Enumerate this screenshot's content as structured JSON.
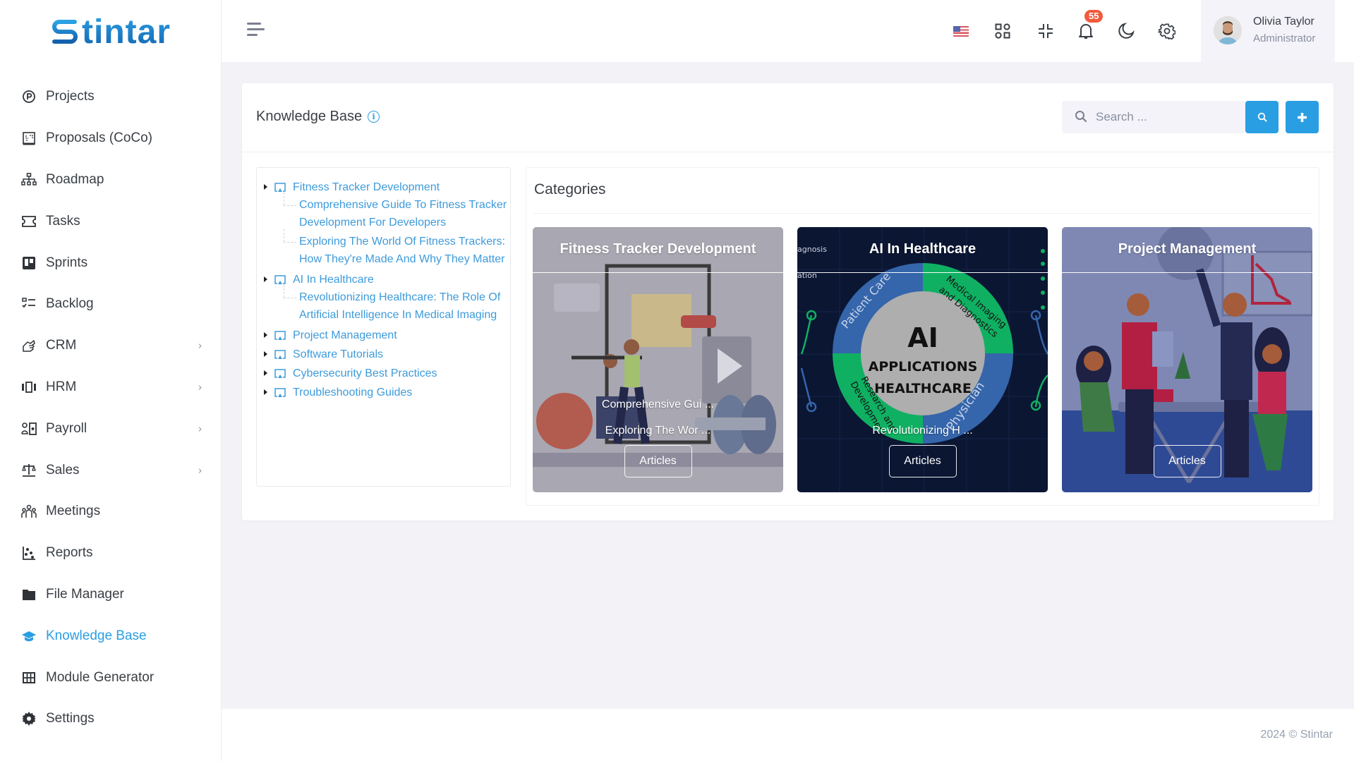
{
  "brand": {
    "name": "tintar",
    "logo_letter": "S"
  },
  "sidebar": {
    "items": [
      {
        "label": "Projects",
        "icon": "circle-p-icon",
        "has_submenu": false,
        "active": false
      },
      {
        "label": "Proposals (CoCo)",
        "icon": "proposal-icon",
        "has_submenu": false,
        "active": false
      },
      {
        "label": "Roadmap",
        "icon": "sitemap-icon",
        "has_submenu": false,
        "active": false
      },
      {
        "label": "Tasks",
        "icon": "ticket-icon",
        "has_submenu": false,
        "active": false
      },
      {
        "label": "Sprints",
        "icon": "board-icon",
        "has_submenu": false,
        "active": false
      },
      {
        "label": "Backlog",
        "icon": "checklist-icon",
        "has_submenu": false,
        "active": false
      },
      {
        "label": "CRM",
        "icon": "handshake-icon",
        "has_submenu": true,
        "active": false
      },
      {
        "label": "HRM",
        "icon": "carousel-icon",
        "has_submenu": true,
        "active": false
      },
      {
        "label": "Payroll",
        "icon": "payroll-icon",
        "has_submenu": true,
        "active": false
      },
      {
        "label": "Sales",
        "icon": "scale-icon",
        "has_submenu": true,
        "active": false
      },
      {
        "label": "Meetings",
        "icon": "team-icon",
        "has_submenu": false,
        "active": false
      },
      {
        "label": "Reports",
        "icon": "scatter-icon",
        "has_submenu": false,
        "active": false
      },
      {
        "label": "File Manager",
        "icon": "folder-icon",
        "has_submenu": false,
        "active": false
      },
      {
        "label": "Knowledge Base",
        "icon": "graduation-cap-icon",
        "has_submenu": false,
        "active": true
      },
      {
        "label": "Module Generator",
        "icon": "grid-icon",
        "has_submenu": false,
        "active": false
      },
      {
        "label": "Settings",
        "icon": "cog-icon",
        "has_submenu": false,
        "active": false
      }
    ]
  },
  "header": {
    "notifications_count": "55",
    "icons": [
      "us-flag-icon",
      "apps-grid-icon",
      "fullscreen-exit-icon",
      "bell-icon",
      "moon-icon",
      "gear-icon"
    ],
    "user": {
      "name": "Olivia Taylor",
      "role": "Administrator"
    }
  },
  "page": {
    "title": "Knowledge Base",
    "search": {
      "placeholder": "Search ...",
      "value": ""
    }
  },
  "tree": [
    {
      "label": "Fitness Tracker Development",
      "children": [
        "Comprehensive Guide To Fitness Tracker Development For Developers",
        "Exploring The World Of Fitness Trackers: How They're Made And Why They Matter"
      ]
    },
    {
      "label": "AI In Healthcare",
      "children": [
        "Revolutionizing Healthcare: The Role Of Artificial Intelligence In Medical Imaging"
      ]
    },
    {
      "label": "Project Management",
      "children": []
    },
    {
      "label": "Software Tutorials",
      "children": []
    },
    {
      "label": "Cybersecurity Best Practices",
      "children": []
    },
    {
      "label": "Troubleshooting Guides",
      "children": []
    }
  ],
  "categories": {
    "title": "Categories",
    "cards": [
      {
        "title": "Fitness Tracker Development",
        "links": [
          "Comprehensive Gui ...",
          "Exploring The Wor ..."
        ],
        "button": "Articles"
      },
      {
        "title": "AI In Healthcare",
        "links": [
          "Revolutionizing H ..."
        ],
        "button": "Articles",
        "image_text": {
          "center_big": "AI",
          "center_line1": "APPLICATIONS",
          "center_line2": "HEALTHCARE",
          "segments": [
            "Patient Care",
            "Medical Imaging and Diagnostics",
            "Research and Development",
            "Physician"
          ],
          "edge_left_1": "agnosis",
          "edge_left_2": "ation"
        }
      },
      {
        "title": "Project Management",
        "links": [],
        "button": "Articles"
      }
    ]
  },
  "footer": {
    "text": "2024 © Stintar"
  }
}
